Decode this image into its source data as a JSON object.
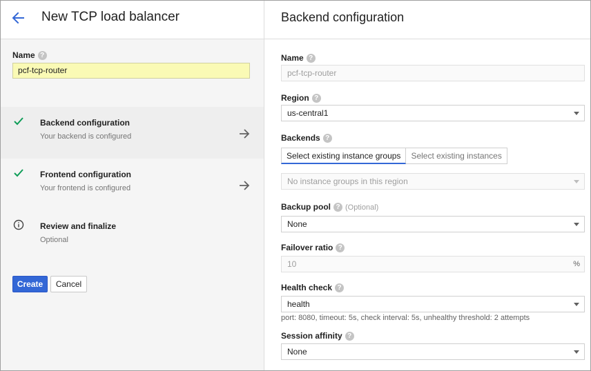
{
  "left": {
    "title": "New TCP load balancer",
    "name_label": "Name",
    "name_value": "pcf-tcp-router",
    "steps": [
      {
        "title": "Backend configuration",
        "subtitle": "Your backend is configured",
        "status": "done"
      },
      {
        "title": "Frontend configuration",
        "subtitle": "Your frontend is configured",
        "status": "done"
      },
      {
        "title": "Review and finalize",
        "subtitle": "Optional",
        "status": "info"
      }
    ],
    "create_label": "Create",
    "cancel_label": "Cancel"
  },
  "right": {
    "title": "Backend configuration",
    "name_label": "Name",
    "name_value": "pcf-tcp-router",
    "region_label": "Region",
    "region_value": "us-central1",
    "backends_label": "Backends",
    "backend_tabs": [
      "Select existing instance groups",
      "Select existing instances"
    ],
    "instance_groups_placeholder": "No instance groups in this region",
    "backup_pool_label": "Backup pool",
    "backup_pool_optional": "(Optional)",
    "backup_pool_value": "None",
    "failover_label": "Failover ratio",
    "failover_value": "10",
    "failover_unit": "%",
    "health_check_label": "Health check",
    "health_check_value": "health",
    "health_check_hint": "port: 8080, timeout: 5s, check interval: 5s, unhealthy threshold: 2 attempts",
    "session_affinity_label": "Session affinity",
    "session_affinity_value": "None"
  },
  "colors": {
    "accent": "#3367d6",
    "check": "#0f9d58",
    "name_highlight": "#fafab5"
  },
  "icons": {
    "back": "arrow-left-icon",
    "step_done": "check-icon",
    "step_info": "info-icon",
    "step_next": "arrow-right-icon",
    "help": "help-icon",
    "dropdown": "caret-down-icon"
  }
}
